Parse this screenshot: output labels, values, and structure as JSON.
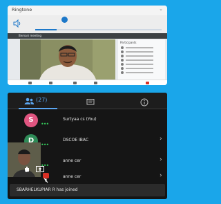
{
  "ringtone": {
    "title": "Ringtone",
    "volume_level": 0.17
  },
  "meeting": {
    "header_title": "Bemani meeting",
    "panel_title": "Participants"
  },
  "tabs": {
    "participants_count": "(27)"
  },
  "participants": [
    {
      "initial": "S",
      "color": "#e05580",
      "name": "Surtyaa cs (You)"
    },
    {
      "initial": "D",
      "color": "#2e8b57",
      "name": "DSCOE IBAC"
    },
    {
      "initial": "",
      "color": "",
      "name": "anne cer"
    },
    {
      "initial": "",
      "color": "",
      "name": "anne cer"
    }
  ],
  "toast": {
    "text": "SBARHELKUPIAR R has joined"
  },
  "colors": {
    "background": "#1aa6ea",
    "accent": "#5ba6f0",
    "presence": "#34c759",
    "end_call": "#d93025"
  }
}
